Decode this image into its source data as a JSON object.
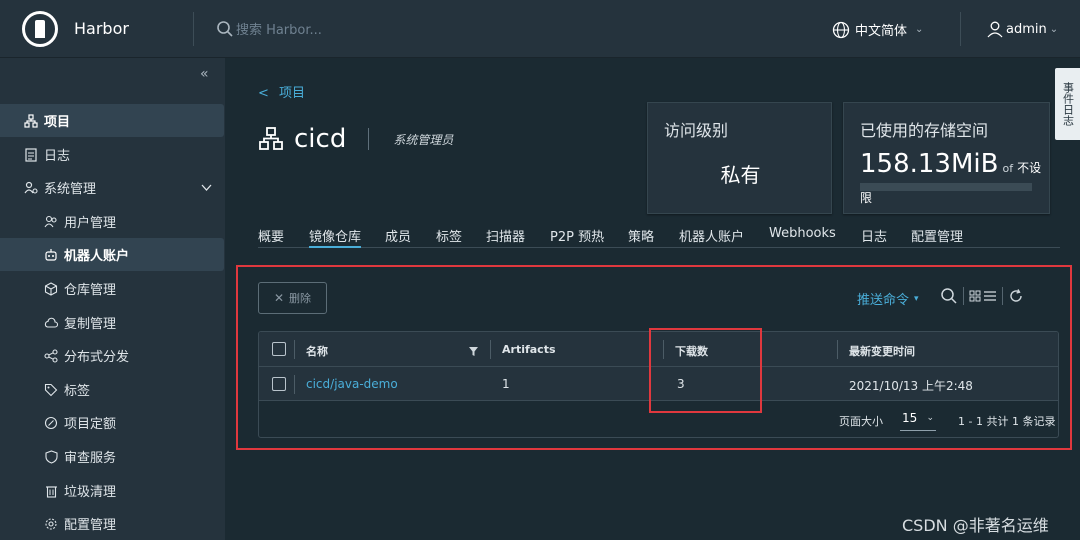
{
  "header": {
    "brand": "Harbor",
    "search_placeholder": "搜索 Harbor...",
    "language": "中文简体",
    "user": "admin"
  },
  "sidebar": {
    "items": [
      {
        "label": "项目",
        "icon": "project-icon",
        "active": true
      },
      {
        "label": "日志",
        "icon": "log-icon"
      },
      {
        "label": "系统管理",
        "icon": "admin-icon",
        "expanded": true
      },
      {
        "label": "用户管理",
        "icon": "users-icon"
      },
      {
        "label": "机器人账户",
        "icon": "robot-icon",
        "active": true
      },
      {
        "label": "仓库管理",
        "icon": "cube-icon"
      },
      {
        "label": "复制管理",
        "icon": "cloud-icon"
      },
      {
        "label": "分布式分发",
        "icon": "share-icon"
      },
      {
        "label": "标签",
        "icon": "tag-icon"
      },
      {
        "label": "项目定额",
        "icon": "quota-icon"
      },
      {
        "label": "审查服务",
        "icon": "shield-icon"
      },
      {
        "label": "垃圾清理",
        "icon": "trash-icon"
      },
      {
        "label": "配置管理",
        "icon": "gear-icon"
      }
    ]
  },
  "breadcrumb": {
    "back": "<",
    "label": "项目"
  },
  "project": {
    "name": "cicd",
    "role": "系统管理员"
  },
  "cards": {
    "access": {
      "title": "访问级别",
      "value": "私有"
    },
    "storage": {
      "title": "已使用的存储空间",
      "value": "158.13MiB",
      "of": "of",
      "limit": "不设限"
    }
  },
  "tabs": [
    "概要",
    "镜像仓库",
    "成员",
    "标签",
    "扫描器",
    "P2P 预热",
    "策略",
    "机器人账户",
    "Webhooks",
    "日志",
    "配置管理"
  ],
  "toolbar": {
    "delete": "删除",
    "push_command": "推送命令"
  },
  "grid": {
    "columns": [
      "名称",
      "Artifacts",
      "下载数",
      "最新变更时间"
    ],
    "rows": [
      {
        "name": "cicd/java-demo",
        "artifacts": "1",
        "downloads": "3",
        "updated": "2021/10/13 上午2:48"
      }
    ],
    "footer": {
      "page_size_label": "页面大小",
      "page_size": "15",
      "summary": "1 - 1 共计 1 条记录"
    }
  },
  "side_tab": "事件日志",
  "watermark": "CSDN @非著名运维",
  "colors": {
    "accent": "#4aaed9",
    "highlight": "#e0383e",
    "background": "#1b2a32",
    "panel": "#25333d"
  }
}
